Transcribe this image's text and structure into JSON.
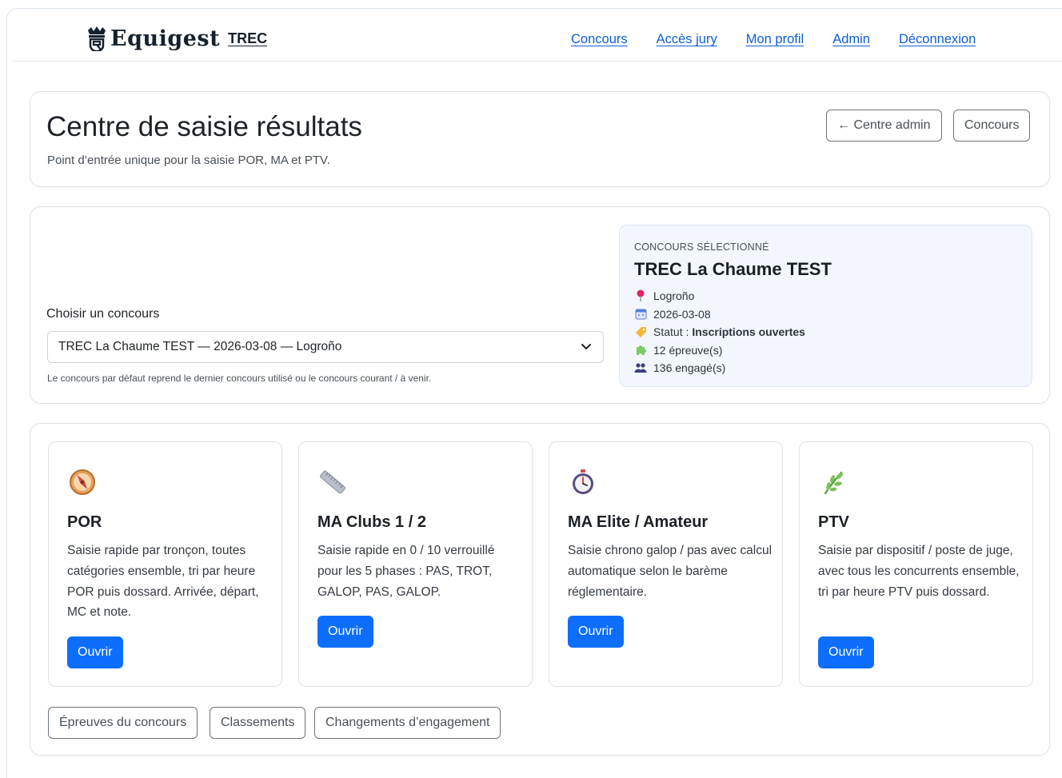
{
  "nav": {
    "brand": "Equigest",
    "brand_sub": "TREC",
    "links": [
      "Concours",
      "Accès jury",
      "Mon profil",
      "Admin",
      "Déconnexion"
    ]
  },
  "header": {
    "title": "Centre de saisie résultats",
    "subtitle": "Point d’entrée unique pour la saisie POR, MA et PTV.",
    "btn_admin": "← Centre admin",
    "btn_concours": "Concours"
  },
  "selector": {
    "label": "Choisir un concours",
    "value": "TREC La Chaume TEST — 2026-03-08 — Logroño",
    "help": "Le concours par défaut reprend le dernier concours utilisé ou le concours courant / à venir."
  },
  "selected": {
    "kicker": "CONCOURS SÉLECTIONNÉ",
    "name": "TREC La Chaume TEST",
    "location": "Logroño",
    "date": "2026-03-08",
    "status_label": "Statut :",
    "status_value": "Inscriptions ouvertes",
    "epreuves": "12 épreuve(s)",
    "engages": "136 engagé(s)"
  },
  "modules": [
    {
      "icon": "compass-icon",
      "title": "POR",
      "desc": "Saisie rapide par tronçon, toutes catégories ensemble, tri par heure POR puis dossard. Arrivée, départ, MC et note.",
      "button": "Ouvrir"
    },
    {
      "icon": "ruler-icon",
      "title": "MA Clubs 1 / 2",
      "desc": "Saisie rapide en 0 / 10 verrouillé pour les 5 phases : PAS, TROT, GALOP, PAS, GALOP.",
      "button": "Ouvrir"
    },
    {
      "icon": "stopwatch-icon",
      "title": "MA Elite / Amateur",
      "desc": "Saisie chrono galop / pas avec calcul automatique selon le barème réglementaire.",
      "button": "Ouvrir"
    },
    {
      "icon": "herb-icon",
      "title": "PTV",
      "desc": "Saisie par dispositif / poste de juge, avec tous les concurrents ensemble, tri par heure PTV puis dossard.",
      "button": "Ouvrir"
    }
  ],
  "bottom_buttons": [
    "Épreuves du concours",
    "Classements",
    "Changements d’engagement"
  ],
  "colors": {
    "primary": "#0d6efd",
    "link": "#0d5fd6",
    "info_bg": "#f3f7fd"
  }
}
